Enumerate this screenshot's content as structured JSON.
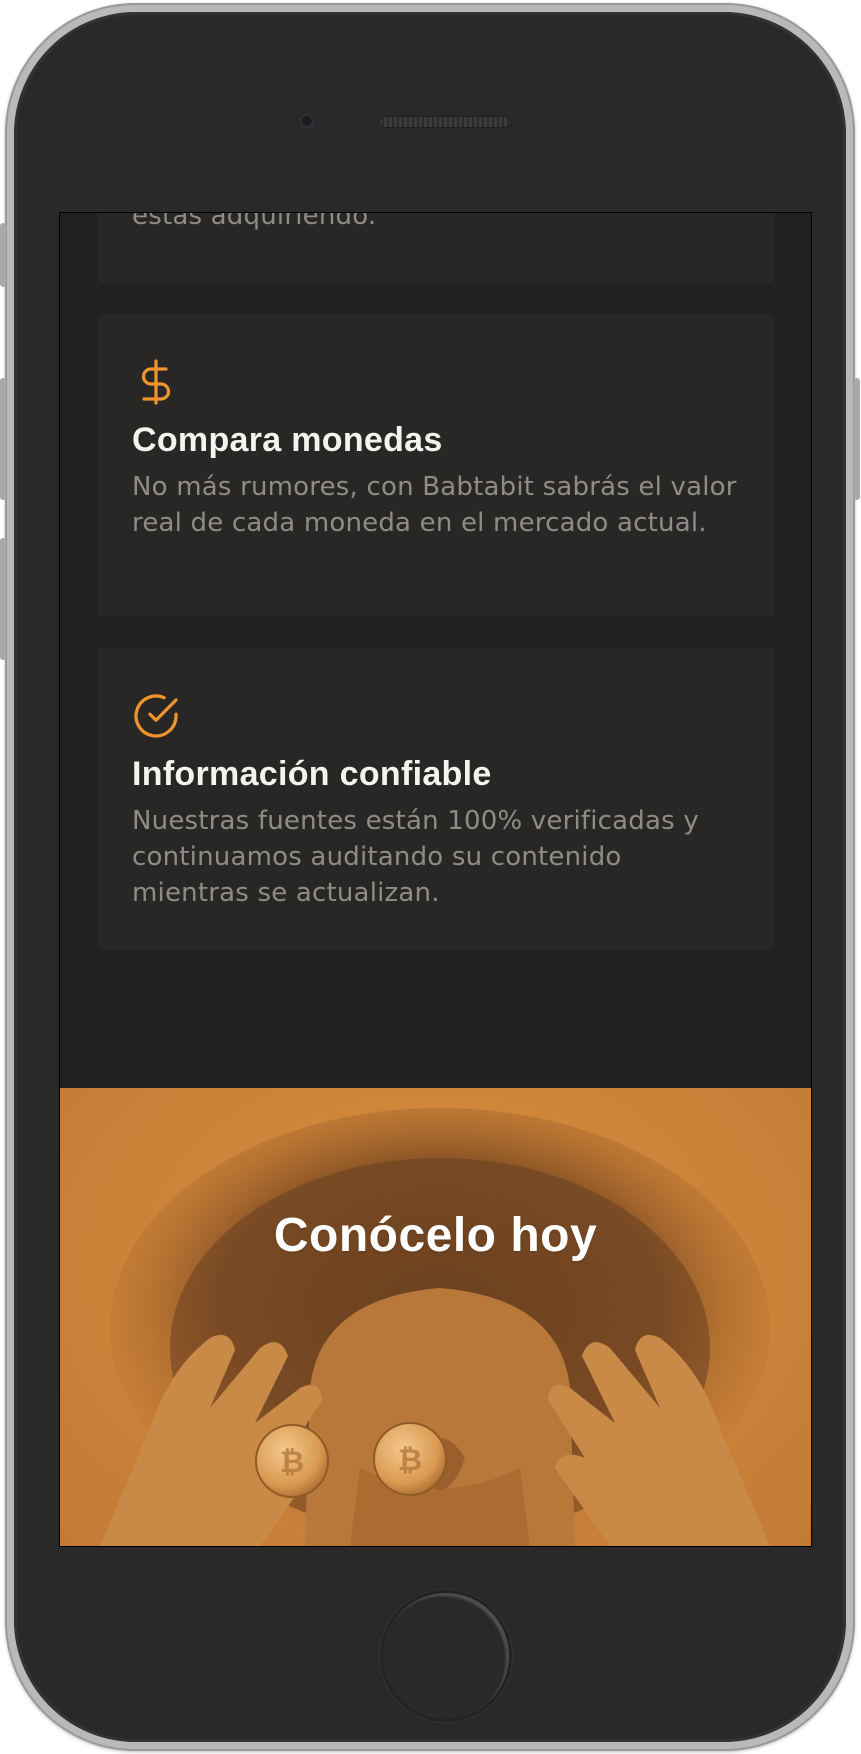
{
  "features": {
    "card_partial": {
      "text": "estás adquiriendo."
    },
    "card_compare": {
      "icon": "dollar-icon",
      "title": "Compara monedas",
      "text": "No más rumores, con Babtabit sabrás el valor real de cada moneda en el mercado actual."
    },
    "card_reliable": {
      "icon": "check-circle-icon",
      "title": "Información confiable",
      "text": "Nuestras fuentes están 100% verificadas y continuamos auditando su contenido mientras se actualizan."
    }
  },
  "hero": {
    "title": "Conócelo hoy",
    "image": "woman-holding-bitcoins-over-eyes"
  },
  "colors": {
    "accent": "#f0952b",
    "background": "#212120",
    "card": "#282726",
    "hero": "#d28a3c"
  }
}
